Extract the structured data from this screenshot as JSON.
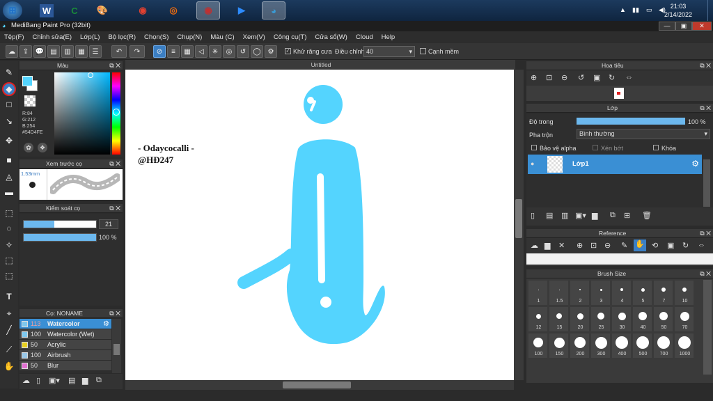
{
  "taskbar": {
    "apps": [
      {
        "name": "windows-start-icon",
        "glyph": "⊞"
      },
      {
        "name": "word-icon",
        "glyph": "W"
      },
      {
        "name": "app-green-icon",
        "glyph": "C"
      },
      {
        "name": "paint-palette-icon",
        "glyph": "🎨"
      },
      {
        "name": "chrome-icon",
        "glyph": "◉"
      },
      {
        "name": "firefox-icon",
        "glyph": "◎"
      },
      {
        "name": "chrome-profile-icon",
        "glyph": "◉"
      },
      {
        "name": "zoom-icon",
        "glyph": "▶"
      },
      {
        "name": "medibang-icon",
        "glyph": "◕"
      }
    ],
    "time": "21:03",
    "date": "2/14/2022"
  },
  "window": {
    "title": "MediBang Paint Pro (32bit)"
  },
  "menu": [
    "Tệp(F)",
    "Chỉnh sửa(E)",
    "Lớp(L)",
    "Bộ lọc(R)",
    "Chọn(S)",
    "Chụp(N)",
    "Màu (C)",
    "Xem(V)",
    "Công cụ(T)",
    "Cửa sổ(W)",
    "Cloud",
    "Help"
  ],
  "toolbar": {
    "antialias_label": "Khử răng cưa",
    "adjust_label": "Điều chỉnh",
    "adjust_value": "40",
    "edge_label": "Cạnh mềm"
  },
  "color_panel": {
    "title": "Màu",
    "r": "R:84",
    "g": "G:212",
    "b": "B:254",
    "hex": "#54D4FE",
    "current_color": "#54D4FE"
  },
  "brush_preview": {
    "title": "Xem trước cọ",
    "size": "1.53mm"
  },
  "brush_control": {
    "title": "Kiểm soát cọ",
    "size_value": "21",
    "opacity_value": "100 %"
  },
  "brush_list": {
    "title": "Cọ: NONAME",
    "items": [
      {
        "size": "113",
        "name": "Watercolor",
        "color": "#7ec8ee"
      },
      {
        "size": "100",
        "name": "Watercolor (Wet)",
        "color": "#7ec8ee"
      },
      {
        "size": "50",
        "name": "Acrylic",
        "color": "#e8d020"
      },
      {
        "size": "100",
        "name": "Airbrush",
        "color": "#9ac8e8"
      },
      {
        "size": "50",
        "name": "Blur",
        "color": "#e070d0"
      }
    ]
  },
  "document": {
    "tab": "Untitled",
    "text_line1": "- Odaycocalli -",
    "text_line2": "@HĐ247",
    "shape_color": "#54D4FE"
  },
  "navigator": {
    "title": "Hoa tiêu"
  },
  "layer_panel": {
    "title": "Lớp",
    "opacity_label": "Độ trong",
    "opacity_value": "100 %",
    "blend_label": "Pha trộn",
    "blend_value": "Bình thường",
    "protect_alpha": "Bảo vệ alpha",
    "clipping": "Xén bớt",
    "lock": "Khóa",
    "layer_name": "Lớp1"
  },
  "reference": {
    "title": "Reference"
  },
  "brush_size": {
    "title": "Brush Size",
    "sizes": [
      "1",
      "1.5",
      "2",
      "3",
      "4",
      "5",
      "7",
      "10",
      "12",
      "15",
      "20",
      "25",
      "30",
      "40",
      "50",
      "70",
      "100",
      "150",
      "200",
      "300",
      "400",
      "500",
      "700",
      "1000"
    ]
  }
}
